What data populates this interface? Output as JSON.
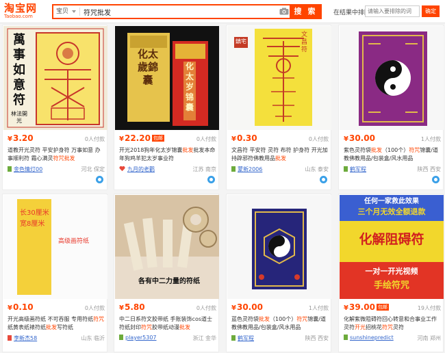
{
  "header": {
    "logo_cn": "淘宝网",
    "logo_en": "Taobao.com",
    "scope_label": "宝贝",
    "query": "符咒批发",
    "search_label": "搜 索",
    "filter_label": "在结果中排除",
    "filter_placeholder": "请输入要排除的词",
    "filter_button": "确定"
  },
  "products": [
    {
      "price": "3.20",
      "currency": "¥",
      "sales": "0人付款",
      "title_a": "道教开光灵符 平安护身符 万事如意 办事顺利符 霜心满灵",
      "title_hl": "符咒批发",
      "title_b": "",
      "shop": "金色情灯00",
      "location": "河北 保定",
      "image_text": [
        "萬",
        "事",
        "如",
        "意",
        "符"
      ],
      "image_text2": "林法開光"
    },
    {
      "price": "22.20",
      "currency": "¥",
      "sales": "0人付款",
      "badge": "包邮",
      "title_a": "开光2018狗年化太岁",
      "title_hl": "开光",
      "title_b": "锦囊",
      "title_c": "批发本命年狗鸡羊犯太岁事业符",
      "title_hl2": "",
      "shop": "九月的老鹳",
      "location": "江苏 南京",
      "image_text": "化太歲錦囊",
      "image_text2": "化太岁锦囊"
    },
    {
      "price": "0.30",
      "currency": "¥",
      "sales": "0人付款",
      "title_a": "文昌符 平安符 灵符 布符 护身符 开光加持辟邪符",
      "title_hl": "开光",
      "title_b": "佛教用品",
      "title_hl2": "批发",
      "shop": "蒙新2006",
      "location": "山东 泰安",
      "image_text": "文昌符",
      "image_text2": "鎮宅"
    },
    {
      "price": "30.00",
      "currency": "¥",
      "sales": "1人付款",
      "title_a": "紫色灵符袋",
      "title_hl": "批发",
      "title_b": "（100个）",
      "title_hl2": "符咒",
      "title_c": "锦囊/道教佛教用品/包装盒/风水用品",
      "shop": "鹤军程",
      "location": "陕西 西安"
    },
    {
      "price": "0.10",
      "currency": "¥",
      "sales": "0人付款",
      "title_a": "开光高级画符纸 不可吞服 专用符纸",
      "title_hl": "符咒",
      "title_b": "纸黄表纸裱符纸",
      "title_hl2": "批发",
      "title_c": "写符纸",
      "shop": "李新杰58",
      "location": "山东 临沂",
      "image_text": "长30厘米",
      "image_text2": "宽8厘米",
      "image_text3": "高级画符纸"
    },
    {
      "price": "5.80",
      "currency": "¥",
      "sales": "0人付款",
      "title_a": "中二日系符文胶带纸 手账装饰cos道士符纸封印",
      "title_hl": "符咒",
      "title_b": "胶带纸动漫",
      "title_hl2": "批发",
      "shop": "player5307",
      "location": "浙江 金华",
      "image_text": "各有中二力量的符纸"
    },
    {
      "price": "30.00",
      "currency": "¥",
      "sales": "1人付款",
      "title_a": "蓝色灵符袋",
      "title_hl": "批发",
      "title_b": "（100个）",
      "title_hl2": "符咒",
      "title_c": "锦囊/道教佛教用品/包装盒/风水用品",
      "shop": "鹤军程",
      "location": "陕西 西安"
    },
    {
      "price": "39.00",
      "currency": "¥",
      "sales": "19人付款",
      "badge": "包邮",
      "title_a": "化解紫微阻碍符回心转意和合事业工作灵符",
      "title_hl": "开光",
      "title_b": "招桃花",
      "title_hl2": "符咒",
      "title_c": "灵符",
      "shop": "sunshinepredict",
      "location": "河南 郑州",
      "image_text": "任何一家救此效果",
      "image_text2": "三个月无效全额退款",
      "image_text3": "化解阻碍符",
      "image_text4": "一对一开光视频",
      "image_text5": "手绘符咒"
    }
  ],
  "colors": {
    "brand": "#ff4400",
    "link": "#3366cc",
    "bg": "#f4f4f4"
  }
}
